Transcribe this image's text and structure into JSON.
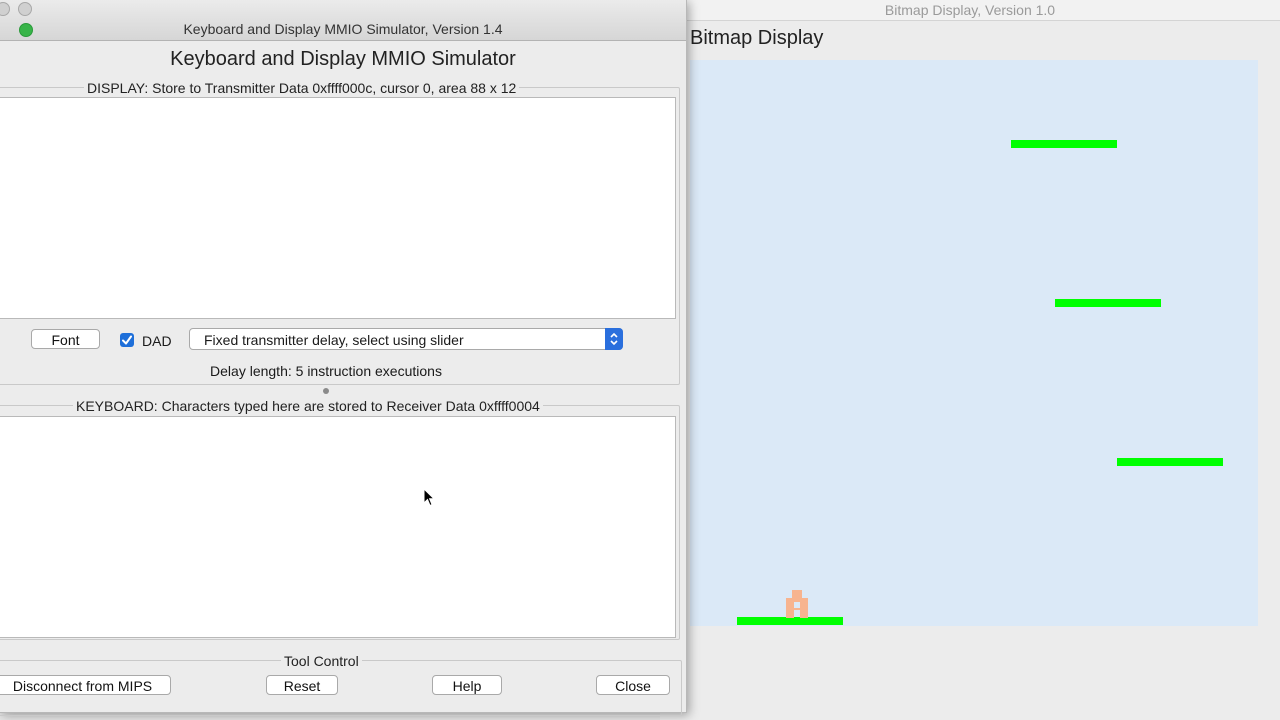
{
  "bitmap_window": {
    "title": "Bitmap Display, Version 1.0",
    "heading": "Bitmap Display",
    "canvas_background": "#dbe9f7",
    "platform_color": "#00ff00",
    "player_color": "#f7b48f"
  },
  "mmio_window": {
    "title": "Keyboard and Display MMIO Simulator, Version 1.4",
    "heading": "Keyboard and Display MMIO Simulator",
    "display": {
      "group_label": "DISPLAY: Store to Transmitter Data 0xffff000c, cursor 0, area 88 x 12",
      "content": "",
      "font_button": "Font",
      "dad_label": "DAD",
      "dad_checked": true,
      "delay_mode": "Fixed transmitter delay, select using slider",
      "delay_length": "Delay length: 5 instruction executions"
    },
    "keyboard": {
      "group_label": "KEYBOARD: Characters typed here are stored to Receiver Data 0xffff0004",
      "content": ""
    },
    "tool_control": {
      "group_label": "Tool Control",
      "disconnect_label": "Disconnect from MIPS",
      "reset_label": "Reset",
      "help_label": "Help",
      "close_label": "Close"
    }
  },
  "colors": {
    "checkbox_accent": "#1e6fd9",
    "zoom_button": "#38b449"
  },
  "icons": [
    "checkmark-icon",
    "updown-chevron-icon",
    "mouse-pointer-icon"
  ]
}
